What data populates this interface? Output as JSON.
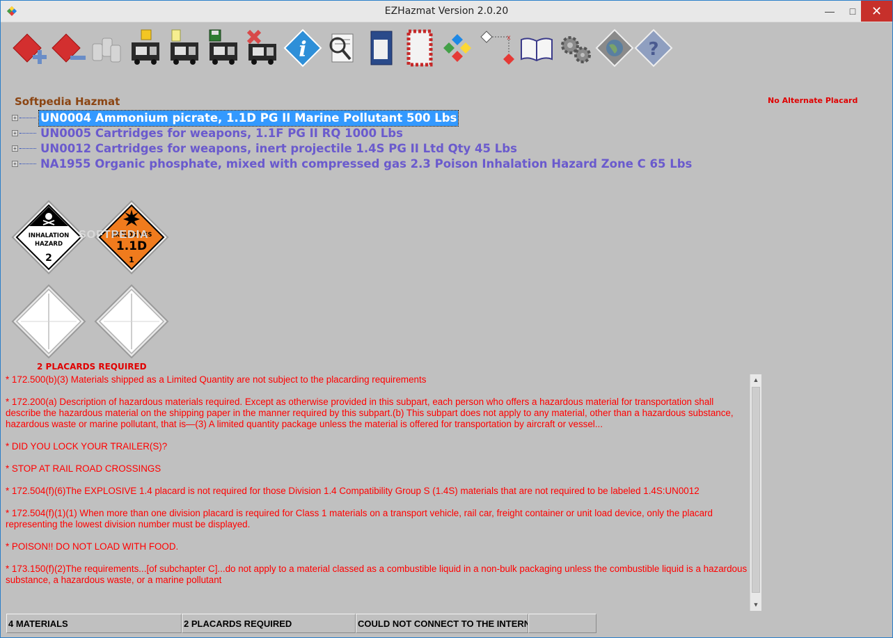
{
  "window": {
    "title": "EZHazmat Version 2.0.20",
    "minimize": "—",
    "maximize": "□",
    "close": "✕"
  },
  "toolbar": [
    {
      "name": "add-material-icon"
    },
    {
      "name": "remove-material-icon"
    },
    {
      "name": "drums-icon"
    },
    {
      "name": "open-truck-icon"
    },
    {
      "name": "new-truck-icon"
    },
    {
      "name": "save-truck-icon"
    },
    {
      "name": "delete-truck-icon"
    },
    {
      "name": "info-icon"
    },
    {
      "name": "search-icon"
    },
    {
      "name": "document-icon"
    },
    {
      "name": "placard-frame-icon"
    },
    {
      "name": "segregation-icon"
    },
    {
      "name": "segregation-table-icon"
    },
    {
      "name": "book-icon"
    },
    {
      "name": "settings-icon"
    },
    {
      "name": "globe-icon"
    },
    {
      "name": "help-icon"
    }
  ],
  "header": {
    "company": "Softpedia Hazmat",
    "alternate_placard": "No Alternate Placard"
  },
  "materials": [
    {
      "label": "UN0004 Ammonium picrate, 1.1D PG II  Marine Pollutant 500 Lbs",
      "selected": true
    },
    {
      "label": "UN0005 Cartridges for weapons, 1.1F PG II RQ 1000 Lbs",
      "selected": false
    },
    {
      "label": "UN0012 Cartridges for weapons, inert projectile 1.4S PG II  Ltd Qty 45 Lbs",
      "selected": false
    },
    {
      "label": "NA1955 Organic phosphate, mixed with compressed gas 2.3  Poison Inhalation Hazard Zone C 65 Lbs",
      "selected": false
    }
  ],
  "placards": {
    "inhalation": {
      "line1": "INHALATION",
      "line2": "HAZARD",
      "class": "2"
    },
    "explosives": {
      "line1": "EXPLOSIVES",
      "division": "1.1D",
      "class": "1"
    },
    "required": "2 PLACARDS REQUIRED",
    "watermark": "SOFTPEDIA"
  },
  "notes": [
    "* 172.500(b)(3) Materials shipped as a Limited Quantity are not subject to the placarding requirements",
    "* 172.200(a) Description of hazardous materials required. Except as otherwise provided in this subpart, each person who offers a hazardous material for transportation shall describe the hazardous material on the shipping paper in the manner required by this subpart.(b) This subpart does not apply to any material, other than a hazardous substance, hazardous waste or marine pollutant, that is—(3) A limited quantity package unless the material is offered for transportation by aircraft or vessel...",
    "* DID YOU LOCK YOUR TRAILER(S)?",
    "* STOP AT RAIL ROAD CROSSINGS",
    "* 172.504(f)(6)The EXPLOSIVE 1.4 placard is not required for those Division 1.4 Compatibility Group S (1.4S) materials that are not required to be labeled 1.4S:UN0012",
    "* 172.504(f)(1)(1) When more than one division placard is required for Class 1 materials on a transport vehicle, rail car, freight container or unit load device, only the placard representing the lowest division number must be displayed.",
    "* POISON!! DO NOT LOAD WITH FOOD.",
    "* 173.150(f)(2)The requirements...[of subchapter C]...do not apply to a material classed as a combustible liquid in a non-bulk packaging unless the combustible liquid is a hazardous substance, a hazardous waste, or a marine pollutant"
  ],
  "scrollbar": {
    "up": "▲",
    "down": "▼"
  },
  "status": {
    "materials": "4 MATERIALS",
    "placards": "2 PLACARDS REQUIRED",
    "connection": "COULD NOT CONNECT TO THE INTERNE",
    "extra": ""
  },
  "colors": {
    "background": "#c0c0c0",
    "note_red": "#ff0000",
    "tree_purple": "#6a5acd",
    "selection": "#3399ff",
    "company_brown": "#8b4513"
  }
}
